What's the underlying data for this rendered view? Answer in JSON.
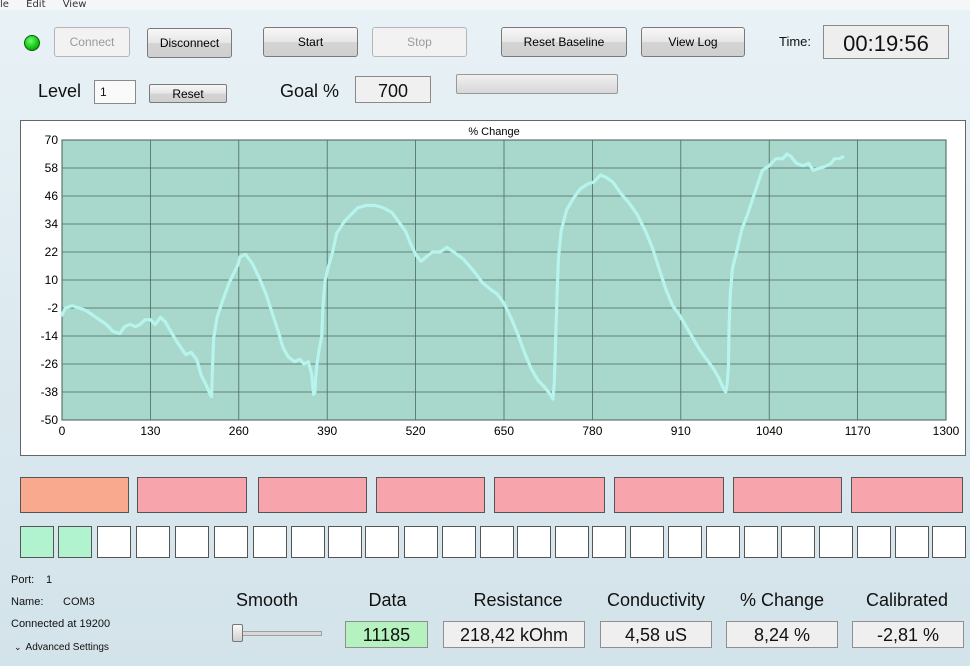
{
  "menu": [
    "le",
    "Edit",
    "View"
  ],
  "toolbar": {
    "connect": "Connect",
    "disconnect": "Disconnect",
    "start": "Start",
    "stop": "Stop",
    "reset_baseline": "Reset Baseline",
    "view_log": "View Log",
    "time_label": "Time:",
    "time_value": "00:19:56"
  },
  "level_row": {
    "level_label": "Level",
    "level_value": "1",
    "reset": "Reset",
    "goal_label": "Goal %",
    "goal_value": "700"
  },
  "chart_data": {
    "type": "scatter",
    "title": "% Change",
    "xlim": [
      0,
      1300
    ],
    "ylim": [
      -50,
      70
    ],
    "x_ticks": [
      0,
      130,
      260,
      390,
      520,
      650,
      780,
      910,
      1040,
      1170,
      1300
    ],
    "y_ticks": [
      70,
      58,
      46,
      34,
      22,
      10,
      -2,
      -14,
      -26,
      -38,
      -50
    ],
    "grid": true,
    "series_color": "#b8f4ee",
    "background_color": "#a8d8cc",
    "anchors": [
      [
        0,
        -5
      ],
      [
        5,
        -2
      ],
      [
        15,
        -1
      ],
      [
        25,
        -2
      ],
      [
        35,
        -3
      ],
      [
        45,
        -5
      ],
      [
        55,
        -7
      ],
      [
        65,
        -9
      ],
      [
        75,
        -12
      ],
      [
        85,
        -13
      ],
      [
        92,
        -10
      ],
      [
        100,
        -9
      ],
      [
        108,
        -10
      ],
      [
        115,
        -9
      ],
      [
        122,
        -7
      ],
      [
        130,
        -7
      ],
      [
        137,
        -9
      ],
      [
        145,
        -6
      ],
      [
        152,
        -8
      ],
      [
        160,
        -12
      ],
      [
        168,
        -16
      ],
      [
        175,
        -19
      ],
      [
        182,
        -22
      ],
      [
        190,
        -21
      ],
      [
        198,
        -24
      ],
      [
        205,
        -31
      ],
      [
        212,
        -35
      ],
      [
        218,
        -39
      ],
      [
        220,
        -40
      ],
      [
        221,
        -30
      ],
      [
        223,
        -15
      ],
      [
        228,
        -6
      ],
      [
        236,
        1
      ],
      [
        246,
        9
      ],
      [
        258,
        16
      ],
      [
        262,
        20
      ],
      [
        270,
        21
      ],
      [
        280,
        17
      ],
      [
        290,
        11
      ],
      [
        300,
        4
      ],
      [
        310,
        -5
      ],
      [
        318,
        -12
      ],
      [
        325,
        -19
      ],
      [
        333,
        -23
      ],
      [
        342,
        -25
      ],
      [
        350,
        -24
      ],
      [
        356,
        -26
      ],
      [
        362,
        -25
      ],
      [
        367,
        -30
      ],
      [
        370,
        -39
      ],
      [
        372,
        -38
      ],
      [
        373,
        -32
      ],
      [
        375,
        -26
      ],
      [
        378,
        -20
      ],
      [
        382,
        -14
      ],
      [
        384,
        0
      ],
      [
        387,
        10
      ],
      [
        392,
        16
      ],
      [
        398,
        22
      ],
      [
        404,
        30
      ],
      [
        415,
        35
      ],
      [
        425,
        38
      ],
      [
        435,
        41
      ],
      [
        448,
        42
      ],
      [
        460,
        42
      ],
      [
        472,
        41
      ],
      [
        485,
        39
      ],
      [
        495,
        35
      ],
      [
        505,
        31
      ],
      [
        512,
        26
      ],
      [
        520,
        21
      ],
      [
        528,
        18
      ],
      [
        536,
        20
      ],
      [
        545,
        22
      ],
      [
        556,
        22
      ],
      [
        566,
        24
      ],
      [
        576,
        22
      ],
      [
        590,
        19
      ],
      [
        605,
        14
      ],
      [
        618,
        9
      ],
      [
        630,
        6
      ],
      [
        640,
        4
      ],
      [
        650,
        0
      ],
      [
        660,
        -6
      ],
      [
        670,
        -13
      ],
      [
        680,
        -21
      ],
      [
        690,
        -28
      ],
      [
        700,
        -33
      ],
      [
        710,
        -36
      ],
      [
        718,
        -39
      ],
      [
        722,
        -41
      ],
      [
        724,
        -34
      ],
      [
        726,
        -15
      ],
      [
        728,
        3
      ],
      [
        730,
        19
      ],
      [
        734,
        31
      ],
      [
        742,
        40
      ],
      [
        752,
        45
      ],
      [
        762,
        49
      ],
      [
        772,
        51
      ],
      [
        782,
        52
      ],
      [
        792,
        55
      ],
      [
        800,
        54
      ],
      [
        810,
        52
      ],
      [
        822,
        47
      ],
      [
        834,
        43
      ],
      [
        846,
        38
      ],
      [
        858,
        31
      ],
      [
        868,
        24
      ],
      [
        878,
        15
      ],
      [
        888,
        6
      ],
      [
        898,
        -1
      ],
      [
        908,
        -5
      ],
      [
        918,
        -10
      ],
      [
        928,
        -15
      ],
      [
        938,
        -20
      ],
      [
        948,
        -24
      ],
      [
        958,
        -28
      ],
      [
        966,
        -32
      ],
      [
        972,
        -36
      ],
      [
        976,
        -38
      ],
      [
        978,
        -35
      ],
      [
        980,
        -28
      ],
      [
        981,
        -10
      ],
      [
        983,
        5
      ],
      [
        986,
        15
      ],
      [
        992,
        22
      ],
      [
        1000,
        32
      ],
      [
        1008,
        38
      ],
      [
        1016,
        45
      ],
      [
        1024,
        52
      ],
      [
        1030,
        57
      ],
      [
        1040,
        59
      ],
      [
        1050,
        62
      ],
      [
        1060,
        62
      ],
      [
        1066,
        64
      ],
      [
        1072,
        63
      ],
      [
        1080,
        60
      ],
      [
        1090,
        59
      ],
      [
        1098,
        60
      ],
      [
        1105,
        57
      ],
      [
        1115,
        58
      ],
      [
        1125,
        59
      ],
      [
        1131,
        60
      ],
      [
        1136,
        62
      ],
      [
        1143,
        62
      ],
      [
        1150,
        63
      ]
    ]
  },
  "levels": {
    "colors": [
      "#f9a98d",
      "#f7a4ad",
      "#f7a4ad",
      "#f7a4ad",
      "#f7a4ad",
      "#f7a4ad",
      "#f7a4ad",
      "#f7a4ad"
    ]
  },
  "steps": {
    "filled_count": 2,
    "total": 25,
    "filled_color": "#b2f3cf"
  },
  "footer": {
    "port_label": "Port:",
    "port_value": "1",
    "name_label": "Name:",
    "name_value": "COM3",
    "connected": "Connected at 19200",
    "advanced": "Advanced Settings",
    "smooth_label": "Smooth",
    "smooth_level": 0.0,
    "data_label": "Data",
    "data_value": "11185",
    "resistance_label": "Resistance",
    "resistance_value": "218,42 kOhm",
    "conductivity_label": "Conductivity",
    "conductivity_value": "4,58 uS",
    "pct_change_label": "% Change",
    "pct_change_value": "8,24 %",
    "calibrated_label": "Calibrated",
    "calibrated_value": "-2,81 %"
  }
}
